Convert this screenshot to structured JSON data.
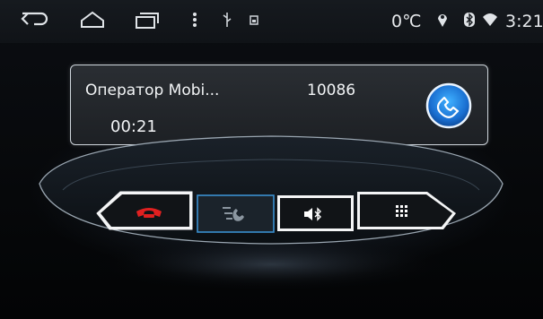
{
  "status_bar": {
    "temperature": "0℃",
    "clock": "3:21",
    "icons": [
      "back-icon",
      "home-icon",
      "recent-apps-icon",
      "menu-dots-icon",
      "usb-icon",
      "screenshot-icon",
      "location-icon",
      "bluetooth-icon",
      "wifi-icon"
    ]
  },
  "call": {
    "caller_name": "Оператор Mobi...",
    "number": "10086",
    "duration": "00:21"
  },
  "controls": [
    {
      "name": "hang-up",
      "icon": "hang-up-icon",
      "color": "#e02020"
    },
    {
      "name": "transfer-to-phone",
      "icon": "handset-transfer-icon",
      "color": "#9aa4ad"
    },
    {
      "name": "mute-mic",
      "icon": "speaker-bluetooth-icon",
      "color": "#ffffff"
    },
    {
      "name": "keypad",
      "icon": "dialpad-icon",
      "color": "#ffffff"
    }
  ],
  "colors": {
    "accent_blue": "#3aa6ff",
    "hangup_red": "#e02020",
    "selected_border": "#3a8fd0"
  }
}
